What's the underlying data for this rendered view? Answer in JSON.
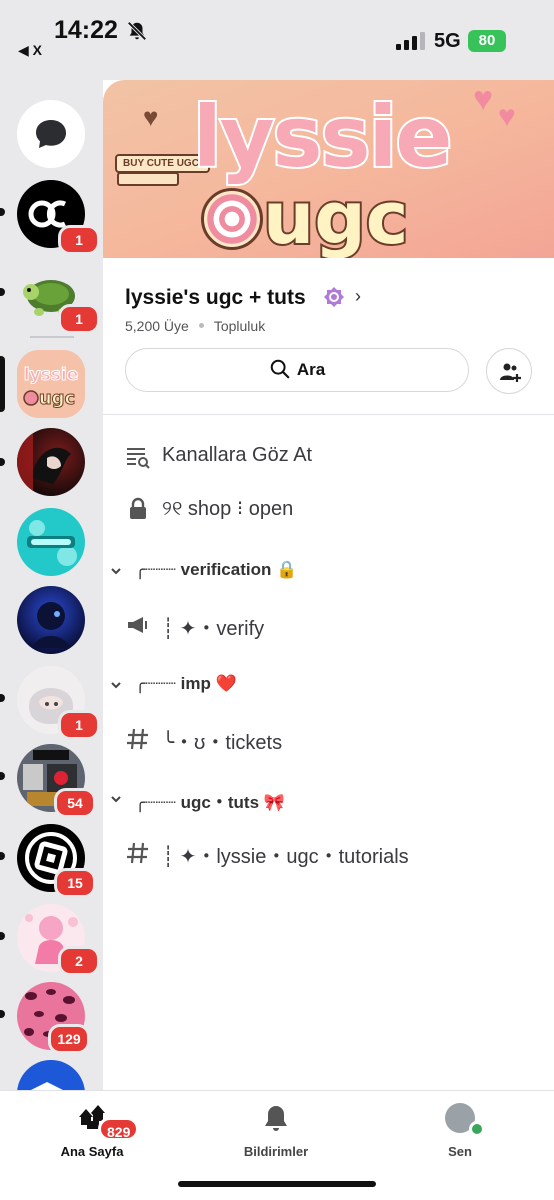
{
  "status_bar": {
    "time": "14:22",
    "back_app": "◀ X",
    "network": "5G",
    "battery": "80"
  },
  "rail": {
    "servers": [
      {
        "name": "DM",
        "icon": "chat-bubble-icon",
        "badge": ""
      },
      {
        "name": "AC",
        "icon": "ac-logo",
        "badge": "1"
      },
      {
        "name": "turtle",
        "icon": "turtle-icon",
        "badge": "1"
      },
      {
        "name": "lyssie ugc",
        "icon": "lyssie-ugc-logo",
        "badge": ""
      },
      {
        "name": "anime dark",
        "icon": "server-avatar",
        "badge": ""
      },
      {
        "name": "cyan",
        "icon": "server-avatar",
        "badge": ""
      },
      {
        "name": "blue",
        "icon": "server-avatar",
        "badge": ""
      },
      {
        "name": "white hair",
        "icon": "server-avatar",
        "badge": "1"
      },
      {
        "name": "vault",
        "icon": "server-avatar",
        "badge": "54"
      },
      {
        "name": "roblox",
        "icon": "roblox-logo",
        "badge": "15"
      },
      {
        "name": "pink",
        "icon": "server-avatar",
        "badge": "2"
      },
      {
        "name": "leopard",
        "icon": "server-avatar",
        "badge": "129"
      },
      {
        "name": "blue partial",
        "icon": "server-avatar",
        "badge": ""
      }
    ]
  },
  "banner": {
    "word1": "lyssie",
    "word2": "ugc",
    "tag": "BUY CUTE UGC!"
  },
  "server": {
    "name": "lyssie's ugc + tuts",
    "members": "5,200 Üye",
    "type": "Topluluk",
    "search_label": "Ara"
  },
  "channels": {
    "browse": "Kanallara Göz At",
    "shop": "୨୧ shop ⁝ open",
    "cat_verification": "╭┈┈┈ verification 🔒",
    "verify": "┊ ✦・verify",
    "cat_imp": "╭┈┈┈ imp ❤️",
    "tickets": "╰・ʊ・tickets",
    "cat_ugc": "╭┈┈┈ ugc・tuts 🎀",
    "tutorials": "┊ ✦・lyssie・ugc・tutorials"
  },
  "bottom_nav": {
    "home": "Ana Sayfa",
    "home_badge": "829",
    "notifications": "Bildirimler",
    "you": "Sen"
  },
  "colors": {
    "accent_badge": "#e53935",
    "rail_bg": "#e9e9ec",
    "online": "#3ba55d"
  }
}
